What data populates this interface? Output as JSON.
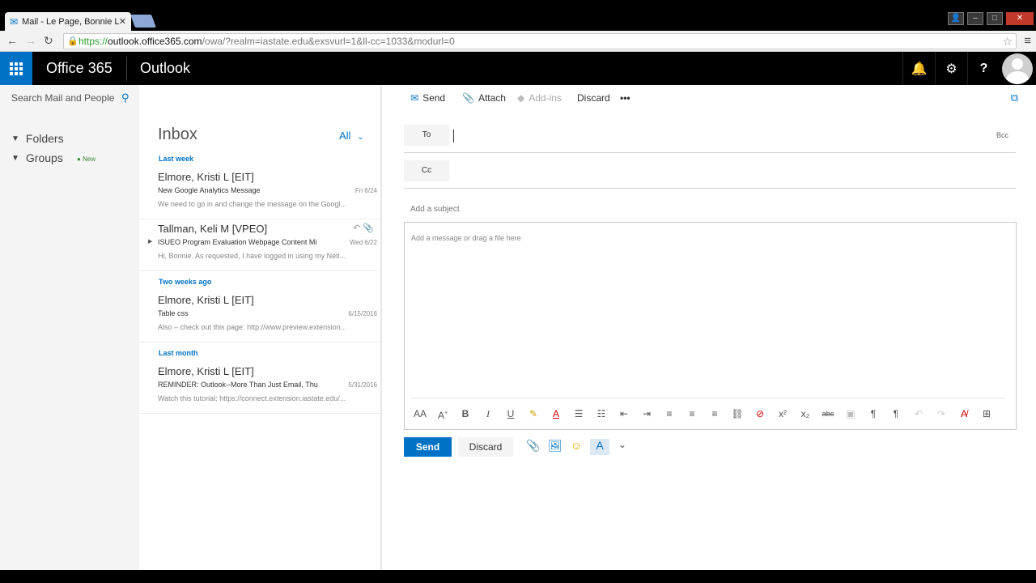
{
  "browser": {
    "tab_title": "Mail - Le Page, Bonnie L",
    "url_prefix": "https://",
    "url_host": "outlook.office365.com",
    "url_path": "/owa/?realm=iastate.edu&exsvurl=1&ll-cc=1033&modurl=0"
  },
  "appbar": {
    "brand": "Office 365",
    "app": "Outlook"
  },
  "leftnav": {
    "search_placeholder": "Search Mail and People",
    "folders": "Folders",
    "groups": "Groups",
    "new_badge": "New"
  },
  "list": {
    "title": "Inbox",
    "filter": "All",
    "groups": [
      {
        "label": "Last week"
      },
      {
        "label": "Two weeks ago"
      },
      {
        "label": "Last month"
      }
    ],
    "messages": [
      {
        "from": "Elmore, Kristi L [EIT]",
        "subject": "New Google Analytics Message",
        "date": "Fri 6/24",
        "preview": "We need to go in and change the message on the Googl..."
      },
      {
        "from": "Tallman, Keli M [VPEO]",
        "subject": "ISUEO Program Evaluation Webpage Content Mi",
        "date": "Wed 6/22",
        "preview": "Hi, Bonnie. As requested, I have logged in using my Neti..."
      },
      {
        "from": "Elmore, Kristi L [EIT]",
        "subject": "Table css",
        "date": "6/15/2016",
        "preview": "Also – check out this page: http://www.preview.extension..."
      },
      {
        "from": "Elmore, Kristi L [EIT]",
        "subject": "REMINDER: Outlook--More Than Just Email, Thu",
        "date": "5/31/2016",
        "preview": "Watch this tutorial: https://connect.extension.iastate.edu/..."
      }
    ]
  },
  "compose": {
    "cmd_send": "Send",
    "cmd_attach": "Attach",
    "cmd_addins": "Add-ins",
    "cmd_discard": "Discard",
    "cmd_more": "•••",
    "to_label": "To",
    "cc_label": "Cc",
    "bcc_label": "Bcc",
    "subject_placeholder": "Add a subject",
    "body_placeholder": "Add a message or drag a file here",
    "send_button": "Send",
    "discard_button": "Discard"
  },
  "colors": {
    "accent": "#0072c6",
    "topbar": "#000000",
    "leftnav_bg": "#f4f4f4"
  }
}
